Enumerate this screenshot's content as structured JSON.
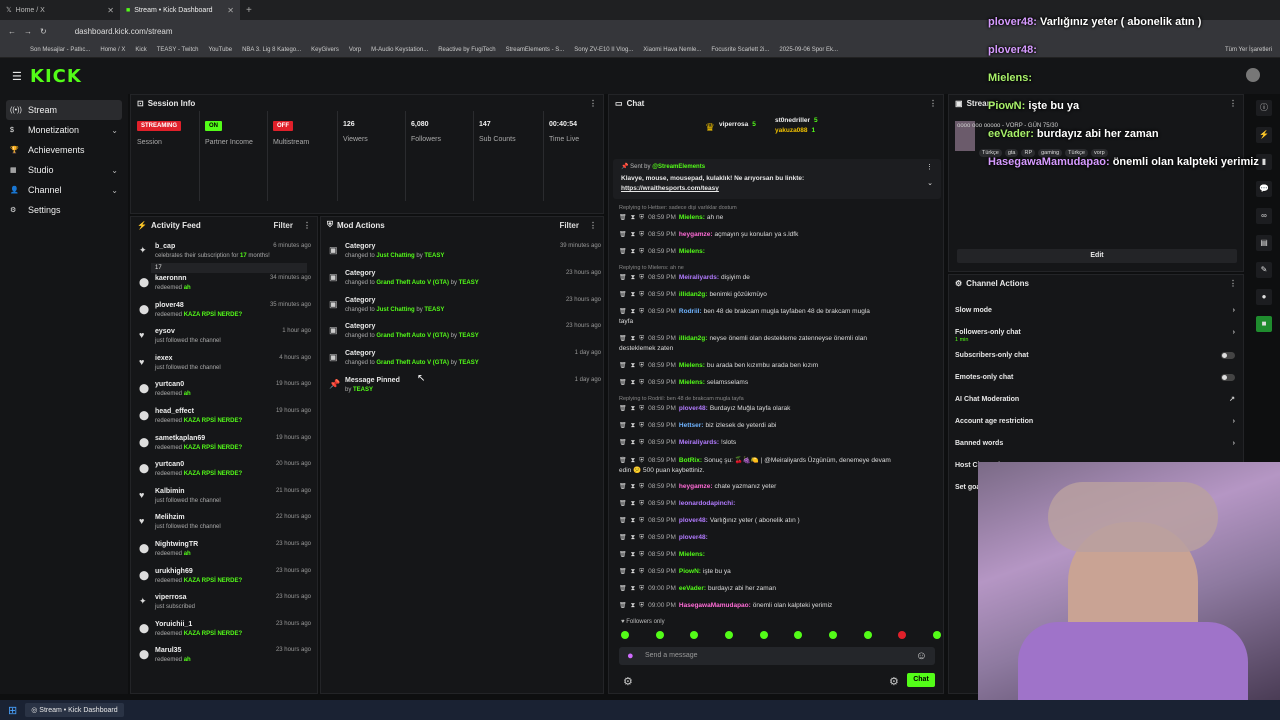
{
  "browser": {
    "tabs": [
      {
        "label": "Home / X"
      },
      {
        "label": "Stream • Kick Dashboard"
      }
    ],
    "url": "dashboard.kick.com/stream",
    "bookmarks": [
      "Son Mesajlar - Patlıc...",
      "Home / X",
      "Kick",
      "TEASY - Twitch",
      "YouTube",
      "NBA 3. Lig 8 Katego...",
      "KeyGivers",
      "Vorp",
      "M-Audio Keystation...",
      "Reactive by FugiTech",
      "StreamElements - S...",
      "Sony ZV-E10 II Vlog...",
      "Xiaomi Hava Nemle...",
      "Focusrite Scarlett 2i...",
      "2025-09-06 Spor Ek..."
    ],
    "all_bookmarks": "Tüm Yer İşaretleri"
  },
  "brand": {
    "logo": "KICK",
    "accent": "#53fc18"
  },
  "sidebar": {
    "items": [
      {
        "label": "Stream",
        "icon": "broadcast-icon"
      },
      {
        "label": "Monetization",
        "icon": "dollar-icon"
      },
      {
        "label": "Achievements",
        "icon": "trophy-icon"
      },
      {
        "label": "Studio",
        "icon": "studio-icon"
      },
      {
        "label": "Channel",
        "icon": "user-icon"
      },
      {
        "label": "Settings",
        "icon": "gear-icon"
      }
    ]
  },
  "session": {
    "title": "Session Info",
    "stats": [
      {
        "value": "STREAMING",
        "label": "Session"
      },
      {
        "value": "ON",
        "label": "Partner Income"
      },
      {
        "value": "OFF",
        "label": "Multistream"
      },
      {
        "value": "126",
        "label": "Viewers"
      },
      {
        "value": "6,080",
        "label": "Followers"
      },
      {
        "value": "147",
        "label": "Sub Counts"
      },
      {
        "value": "00:40:54",
        "label": "Time Live"
      }
    ]
  },
  "activity": {
    "title": "Activity Feed",
    "filter": "Filter",
    "items": [
      {
        "name": "b_cap",
        "sub": "celebrates their subscription for ",
        "hl": "17",
        "sub2": " months!",
        "time": "6 minutes ago",
        "icon": "star-icon",
        "extra": "17"
      },
      {
        "name": "kaeronnn",
        "sub": "redeemed ",
        "hl": "ah",
        "time": "34 minutes ago",
        "icon": "redeem-icon"
      },
      {
        "name": "plover48",
        "sub": "redeemed ",
        "hl": "KAZA RPSİ NERDE?",
        "time": "35 minutes ago",
        "icon": "redeem-icon"
      },
      {
        "name": "eysov",
        "sub": "just followed the channel",
        "time": "1 hour ago",
        "icon": "heart-icon"
      },
      {
        "name": "iexex",
        "sub": "just followed the channel",
        "time": "4 hours ago",
        "icon": "heart-icon"
      },
      {
        "name": "yurtcan0",
        "sub": "redeemed ",
        "hl": "ah",
        "time": "19 hours ago",
        "icon": "redeem-icon"
      },
      {
        "name": "head_effect",
        "sub": "redeemed ",
        "hl": "KAZA RPSİ NERDE?",
        "time": "19 hours ago",
        "icon": "redeem-icon"
      },
      {
        "name": "sametkaplan69",
        "sub": "redeemed ",
        "hl": "KAZA RPSİ NERDE?",
        "time": "19 hours ago",
        "icon": "redeem-icon"
      },
      {
        "name": "yurtcan0",
        "sub": "redeemed ",
        "hl": "KAZA RPSİ NERDE?",
        "time": "20 hours ago",
        "icon": "redeem-icon"
      },
      {
        "name": "Kalbimin",
        "sub": "just followed the channel",
        "time": "21 hours ago",
        "icon": "heart-icon"
      },
      {
        "name": "Melihzim",
        "sub": "just followed the channel",
        "time": "22 hours ago",
        "icon": "heart-icon"
      },
      {
        "name": "NightwingTR",
        "sub": "redeemed ",
        "hl": "ah",
        "time": "23 hours ago",
        "icon": "redeem-icon"
      },
      {
        "name": "urukhigh69",
        "sub": "redeemed ",
        "hl": "KAZA RPSİ NERDE?",
        "time": "23 hours ago",
        "icon": "redeem-icon"
      },
      {
        "name": "viperrosa",
        "sub": "just subscribed",
        "time": "23 hours ago",
        "icon": "star-icon"
      },
      {
        "name": "Yoruichii_1",
        "sub": "redeemed ",
        "hl": "KAZA RPSİ NERDE?",
        "time": "23 hours ago",
        "icon": "redeem-icon"
      },
      {
        "name": "Marul35",
        "sub": "redeemed ",
        "hl": "ah",
        "time": "23 hours ago",
        "icon": "redeem-icon"
      }
    ]
  },
  "mod": {
    "title": "Mod Actions",
    "filter": "Filter",
    "items": [
      {
        "name": "Category",
        "pre": "changed to ",
        "hl": "Just Chatting",
        "by": " by ",
        "who": "TEASY",
        "time": "39 minutes ago"
      },
      {
        "name": "Category",
        "pre": "changed to ",
        "hl": "Grand Theft Auto V (GTA)",
        "by": " by ",
        "who": "TEASY",
        "time": "23 hours ago"
      },
      {
        "name": "Category",
        "pre": "changed to ",
        "hl": "Just Chatting",
        "by": " by ",
        "who": "TEASY",
        "time": "23 hours ago"
      },
      {
        "name": "Category",
        "pre": "changed to ",
        "hl": "Grand Theft Auto V (GTA)",
        "by": " by ",
        "who": "TEASY",
        "time": "23 hours ago"
      },
      {
        "name": "Category",
        "pre": "changed to ",
        "hl": "Grand Theft Auto V (GTA)",
        "by": " by ",
        "who": "TEASY",
        "time": "1 day ago"
      },
      {
        "name": "Message Pinned",
        "pre": "by ",
        "hl": "TEASY",
        "by": "",
        "who": "",
        "time": "1 day ago"
      }
    ]
  },
  "chat": {
    "title": "Chat",
    "top": [
      {
        "name": "viperrosa",
        "v": "5"
      },
      {
        "name": "st0nedriller",
        "v": "5"
      },
      {
        "name": "yakuza088",
        "v": "1"
      }
    ],
    "pinned": {
      "sender": "Sent by",
      "sender_name": "@StreamElements",
      "text": "Klavye, mouse, mousepad, kulaklık! Ne arıyorsan bu linkte:",
      "link": "https://wraithesports.com/teasy"
    },
    "reply0": "Replying to Hettser: sadece dişi varlıklar dostum",
    "messages": [
      {
        "t": "08:59 PM",
        "u": "Mielens:",
        "c": "#53fc18",
        "m": "ah ne"
      },
      {
        "t": "08:59 PM",
        "u": "heygamze:",
        "c": "#ff6bd6",
        "m": "açmayın şu konuları ya s.ldfk"
      },
      {
        "t": "08:59 PM",
        "u": "Mielens:",
        "c": "#53fc18",
        "m": ""
      },
      {
        "t": "08:59 PM",
        "u": "Meiraliyards:",
        "c": "#b27bff",
        "m": "dişiyim de",
        "reply": "Replying to Mielens: ah ne"
      },
      {
        "t": "08:59 PM",
        "u": "illidan2g:",
        "c": "#53fc18",
        "m": "benimki gözükmüyo"
      },
      {
        "t": "08:59 PM",
        "u": "Rodriil:",
        "c": "#6fb4ff",
        "m": "ben 48 de brakcam mugla tayfaben 48 de brakcam mugla"
      },
      {
        "t": "",
        "u": "",
        "c": "#ddd",
        "m": "tayfa"
      },
      {
        "t": "08:59 PM",
        "u": "illidan2g:",
        "c": "#53fc18",
        "m": "neyse önemli olan destekleme zatenneyse önemli olan"
      },
      {
        "t": "",
        "u": "",
        "c": "#ddd",
        "m": "desteklemek zaten"
      },
      {
        "t": "08:59 PM",
        "u": "Mielens:",
        "c": "#53fc18",
        "m": "bu arada ben kızımbu arada ben kızım"
      },
      {
        "t": "08:59 PM",
        "u": "Mielens:",
        "c": "#53fc18",
        "m": "selamsselams"
      },
      {
        "t": "08:59 PM",
        "u": "plover48:",
        "c": "#b27bff",
        "m": "Burdayız Muğla tayfa olarak",
        "reply": "Replying to Rodriil: ben 48 de brakcam mugla tayfa"
      },
      {
        "t": "08:59 PM",
        "u": "Hettser:",
        "c": "#6fb4ff",
        "m": "biz izlesek de yeterdi abi"
      },
      {
        "t": "08:59 PM",
        "u": "Meiraliyards:",
        "c": "#b27bff",
        "m": "!slots"
      },
      {
        "t": "08:59 PM",
        "u": "BotRix:",
        "c": "#53fc18",
        "m": "Sonuç şu: 🍒🍇🍋 | @Meiraliyards Üzgünüm, denemeye devam"
      },
      {
        "t": "",
        "u": "",
        "c": "#ddd",
        "m": "edin 😕 500 puan kaybettiniz."
      },
      {
        "t": "08:59 PM",
        "u": "heygamze:",
        "c": "#ff6bd6",
        "m": "chate yazmanız yeter"
      },
      {
        "t": "08:59 PM",
        "u": "leonardodapinchi:",
        "c": "#b27bff",
        "m": ""
      },
      {
        "t": "08:59 PM",
        "u": "plover48:",
        "c": "#b27bff",
        "m": "Varlığınız yeter ( abonelik atın )"
      },
      {
        "t": "08:59 PM",
        "u": "plover48:",
        "c": "#b27bff",
        "m": ""
      },
      {
        "t": "08:59 PM",
        "u": "Mielens:",
        "c": "#53fc18",
        "m": ""
      },
      {
        "t": "08:59 PM",
        "u": "PiowN:",
        "c": "#53fc18",
        "m": "işte bu ya"
      },
      {
        "t": "09:00 PM",
        "u": "eeVader:",
        "c": "#53fc18",
        "m": "burdayız abi her zaman"
      },
      {
        "t": "09:00 PM",
        "u": "HasegawaMamudapao:",
        "c": "#ff6bd6",
        "m": "önemli olan kalpteki yerimiz"
      }
    ],
    "followers_only": "Followers only",
    "placeholder": "Send a message",
    "send": "Chat"
  },
  "stream_panel": {
    "title": "Stream",
    "meta": "oooo ooo ooooo - VORP - GÜN 75/30",
    "tags": [
      "Türkçe",
      "gta",
      "RP",
      "gaming",
      "Türkçe",
      "vorp"
    ],
    "edit": "Edit"
  },
  "channel_actions": {
    "title": "Channel Actions",
    "items": [
      {
        "label": "Slow mode",
        "type": "chevron"
      },
      {
        "label": "Followers-only chat",
        "sub": "1 min",
        "type": "chevron"
      },
      {
        "label": "Subscribers-only chat",
        "type": "toggle"
      },
      {
        "label": "Emotes-only chat",
        "type": "toggle"
      },
      {
        "label": "AI Chat Moderation",
        "type": "link"
      },
      {
        "label": "Account age restriction",
        "type": "chevron"
      },
      {
        "label": "Banned words",
        "type": "chevron"
      },
      {
        "label": "Host Channel",
        "type": "none"
      },
      {
        "label": "Set goal",
        "type": "none"
      }
    ]
  },
  "overlay": [
    {
      "u": "plover48:",
      "m": " Varlığınız yeter ( abonelik atın )",
      "c": "#d69bff"
    },
    {
      "u": "plover48:",
      "m": "",
      "c": "#d69bff"
    },
    {
      "u": "Mielens:",
      "m": "",
      "c": "#a8f06a"
    },
    {
      "u": "PiowN:",
      "m": " işte bu ya",
      "c": "#a8f06a"
    },
    {
      "u": "eeVader:",
      "m": " burdayız abi her zaman",
      "c": "#a8f06a"
    },
    {
      "u": "HasegawaMamudapao:",
      "m": " önemli olan kalpteki yerimiz",
      "c": "#d69bff"
    }
  ],
  "taskbar": {
    "app": "Stream • Kick Dashboard"
  }
}
